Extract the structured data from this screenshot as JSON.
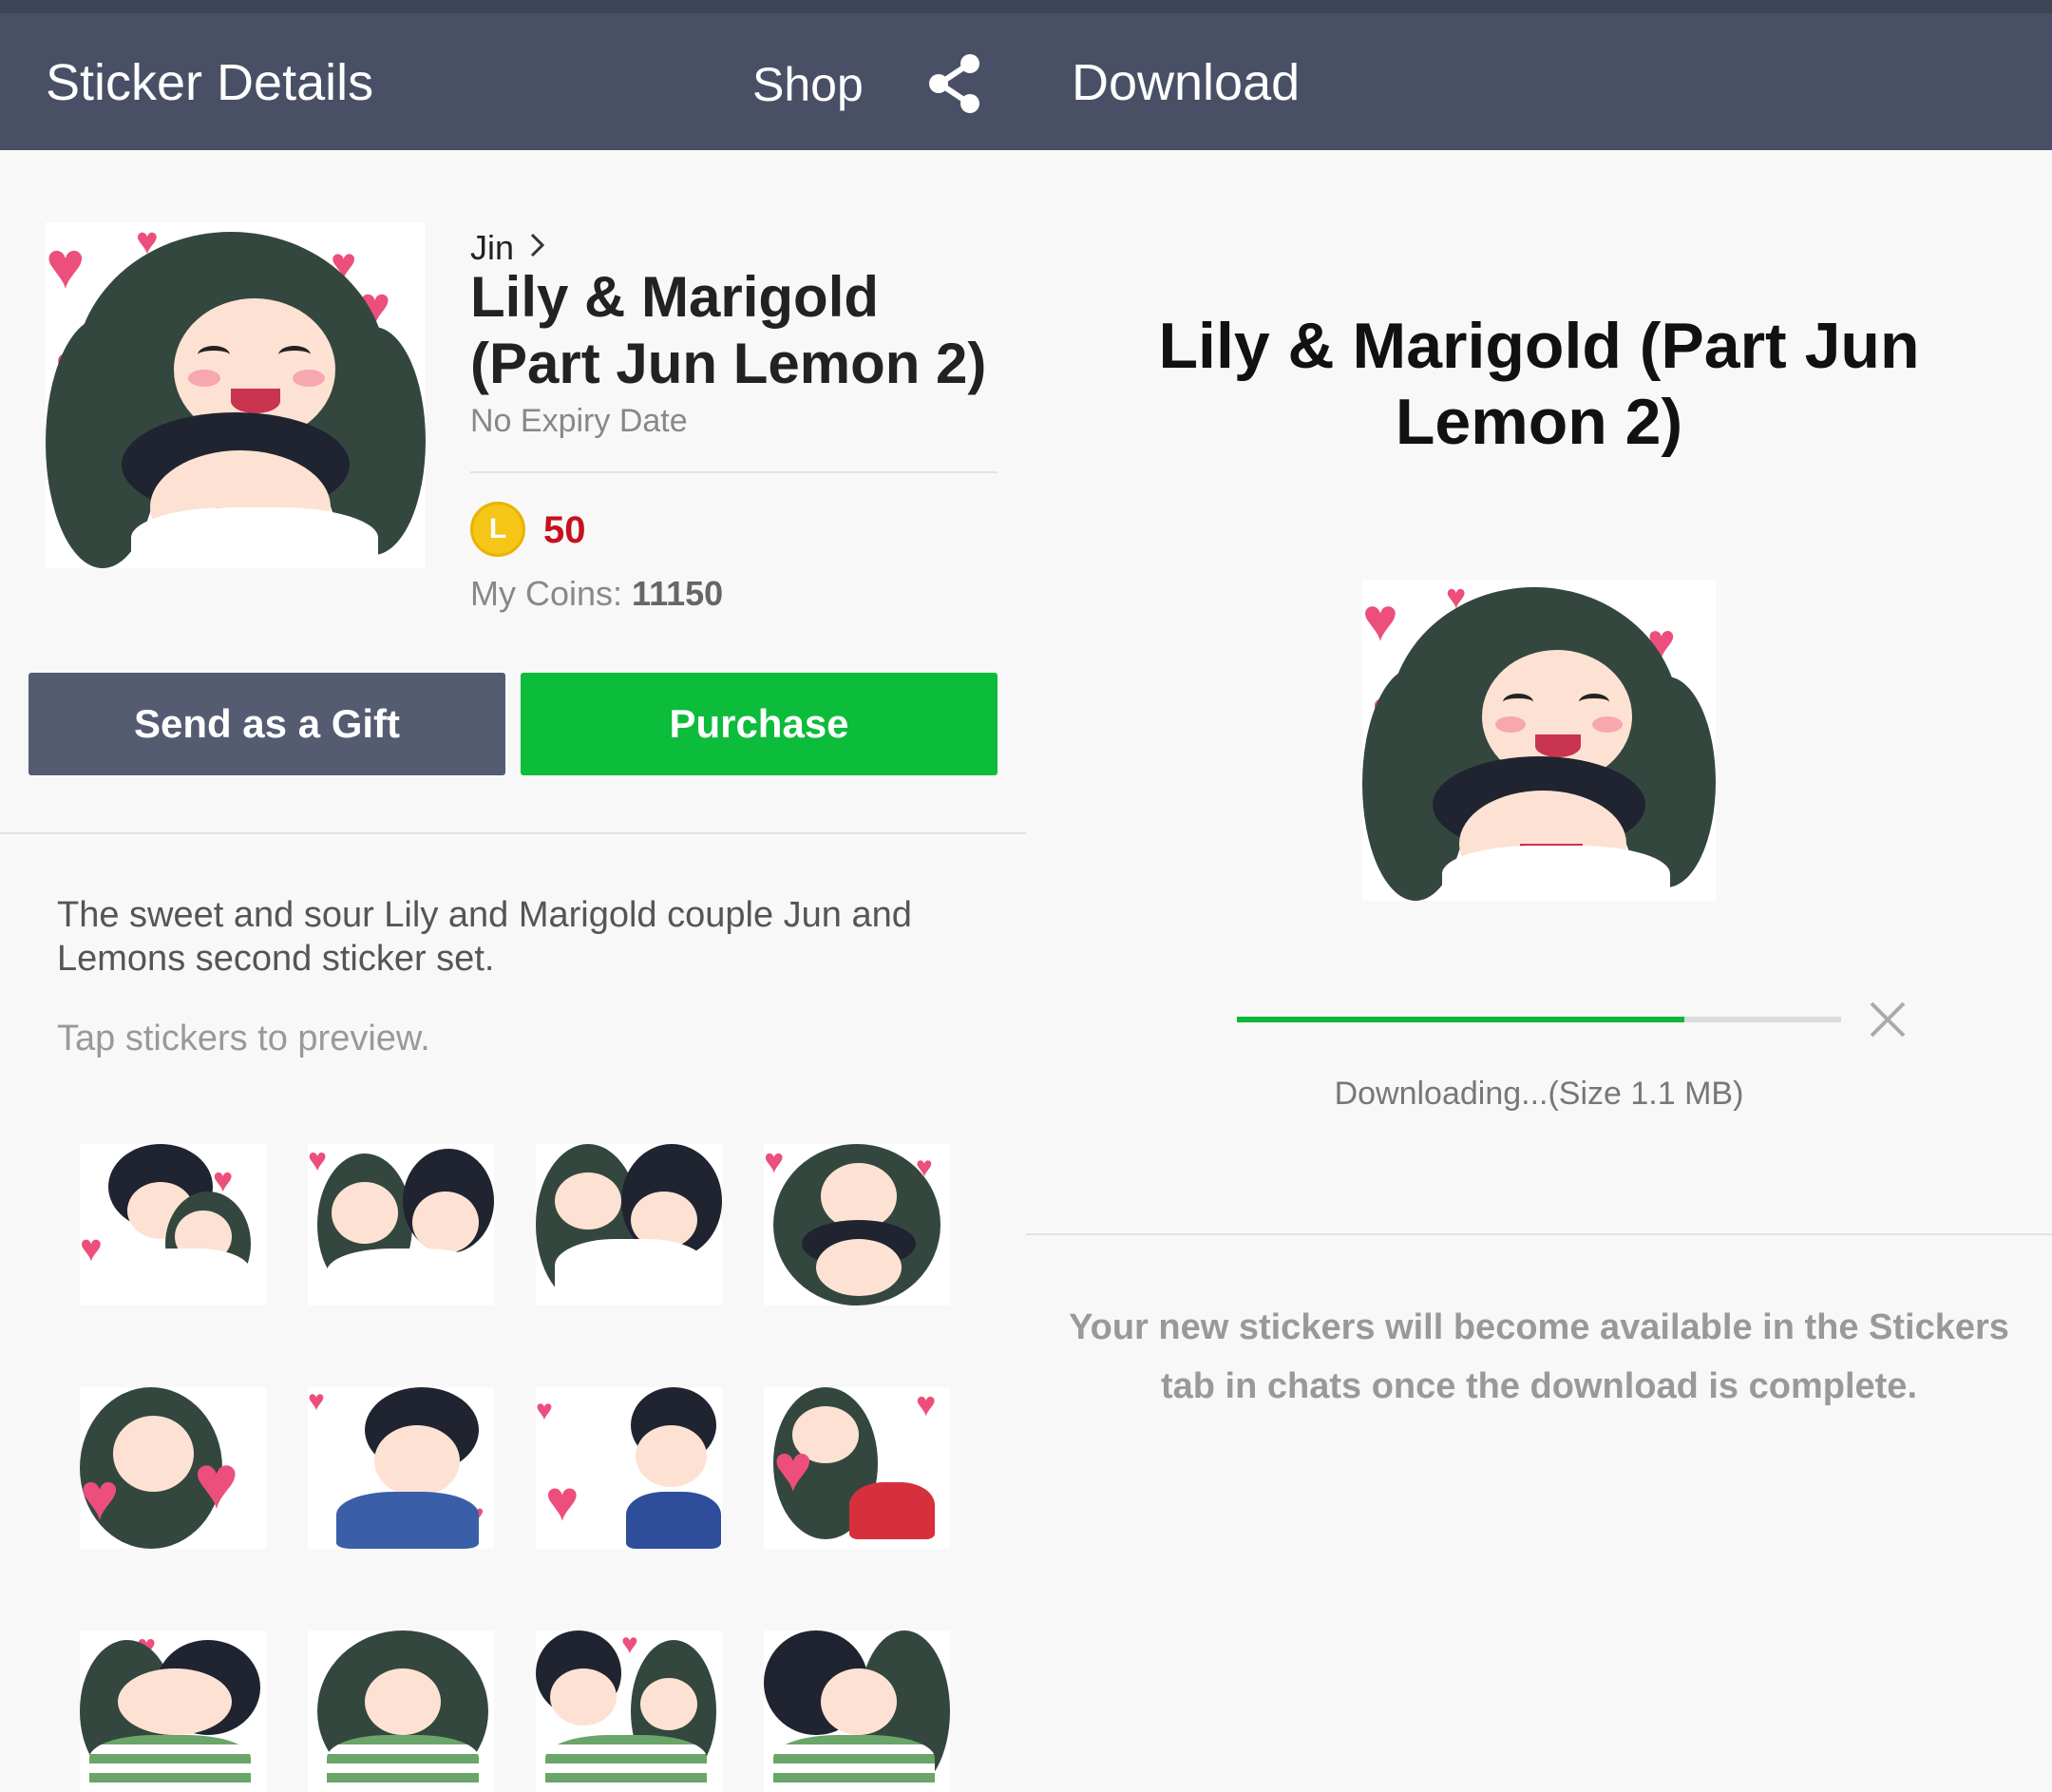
{
  "header": {
    "title": "Sticker Details",
    "shop_label": "Shop",
    "share_icon": "share-icon",
    "download_title": "Download"
  },
  "product": {
    "author": "Jin",
    "title": "Lily & Marigold (Part Jun Lemon 2)",
    "expiry": "No Expiry Date",
    "coin_symbol": "L",
    "price": "50",
    "my_coins_label": "My Coins:",
    "my_coins_value": "11150"
  },
  "actions": {
    "gift_label": "Send as a Gift",
    "purchase_label": "Purchase"
  },
  "description": {
    "text": "The sweet and sour Lily and Marigold couple Jun and Lemons second sticker set.",
    "hint": "Tap stickers to preview."
  },
  "download": {
    "title": "Lily & Marigold (Part Jun Lemon 2)",
    "progress_fraction": 0.74,
    "status": "Downloading...(Size 1.1 MB)",
    "note": "Your new stickers will become available in the Stickers tab in chats once the download is complete."
  },
  "colors": {
    "header_bg": "#495065",
    "gift_button": "#555c72",
    "purchase_button": "#0cbc3b",
    "price": "#c8101e",
    "progress": "#0fb638",
    "coin": "#f5c518"
  }
}
